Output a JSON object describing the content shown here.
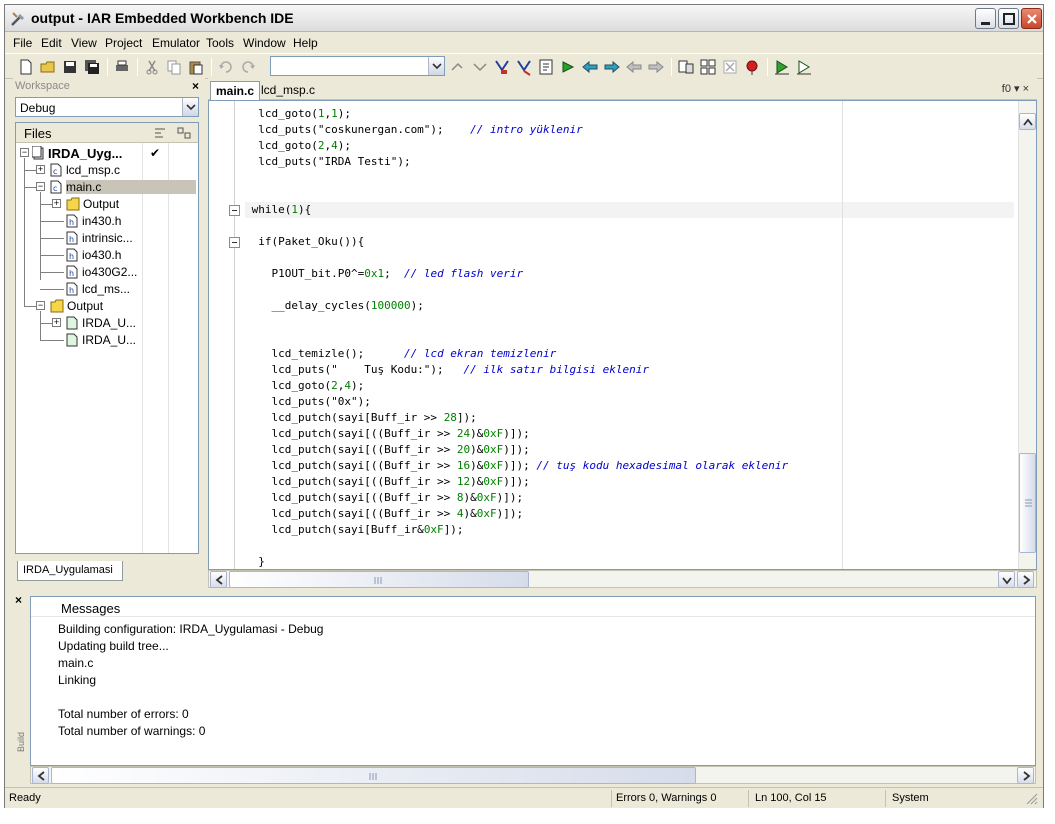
{
  "window": {
    "title": "output - IAR Embedded Workbench IDE"
  },
  "menu": [
    "File",
    "Edit",
    "View",
    "Project",
    "Emulator",
    "Tools",
    "Window",
    "Help"
  ],
  "workspace": {
    "title": "Workspace",
    "close": "×",
    "config": "Debug",
    "files_header": "Files",
    "tab": "IRDA_Uygulamasi",
    "tree": [
      {
        "label": "IRDA_Uyg...",
        "check": "✔"
      },
      {
        "label": "lcd_msp.c"
      },
      {
        "label": "main.c"
      },
      {
        "label": "Output"
      },
      {
        "label": "in430.h"
      },
      {
        "label": "intrinsic..."
      },
      {
        "label": "io430.h"
      },
      {
        "label": "io430G2..."
      },
      {
        "label": "lcd_ms..."
      },
      {
        "label": "Output"
      },
      {
        "label": "IRDA_U..."
      },
      {
        "label": "IRDA_U..."
      }
    ]
  },
  "editor": {
    "tabs": [
      "main.c",
      "lcd_msp.c"
    ],
    "right_label": "f0 ▾ ×",
    "lines": [
      {
        "code": "  lcd_goto(1,1);",
        "comment": ""
      },
      {
        "code": "  lcd_puts(\"coskunergan.com\");",
        "comment": "    // intro yüklenir"
      },
      {
        "code": "  lcd_goto(2,4);",
        "comment": ""
      },
      {
        "code": "  lcd_puts(\"IRDA Testi\");",
        "comment": ""
      },
      {
        "code": "",
        "comment": ""
      },
      {
        "code": "",
        "comment": ""
      },
      {
        "code": " while(1){",
        "comment": ""
      },
      {
        "code": "",
        "comment": ""
      },
      {
        "code": "  if(Paket_Oku()){",
        "comment": ""
      },
      {
        "code": "",
        "comment": ""
      },
      {
        "code": "    P1OUT_bit.P0^=0x1;",
        "comment": "  // led flash verir"
      },
      {
        "code": "",
        "comment": ""
      },
      {
        "code": "    __delay_cycles(100000);",
        "comment": ""
      },
      {
        "code": "",
        "comment": ""
      },
      {
        "code": "",
        "comment": ""
      },
      {
        "code": "    lcd_temizle();",
        "comment": "      // lcd ekran temizlenir"
      },
      {
        "code": "    lcd_puts(\"    Tuş Kodu:\");",
        "comment": "   // ilk satır bilgisi eklenir"
      },
      {
        "code": "    lcd_goto(2,4);",
        "comment": ""
      },
      {
        "code": "    lcd_puts(\"0x\");",
        "comment": ""
      },
      {
        "code": "    lcd_putch(sayi[Buff_ir >> 28]);",
        "comment": ""
      },
      {
        "code": "    lcd_putch(sayi[((Buff_ir >> 24)&0xF)]);",
        "comment": ""
      },
      {
        "code": "    lcd_putch(sayi[((Buff_ir >> 20)&0xF)]);",
        "comment": ""
      },
      {
        "code": "    lcd_putch(sayi[((Buff_ir >> 16)&0xF)]);",
        "comment": " // tuş kodu hexadesimal olarak eklenir"
      },
      {
        "code": "    lcd_putch(sayi[((Buff_ir >> 12)&0xF)]);",
        "comment": ""
      },
      {
        "code": "    lcd_putch(sayi[((Buff_ir >> 8)&0xF)]);",
        "comment": ""
      },
      {
        "code": "    lcd_putch(sayi[((Buff_ir >> 4)&0xF)]);",
        "comment": ""
      },
      {
        "code": "    lcd_putch(sayi[Buff_ir&0xF]);",
        "comment": ""
      },
      {
        "code": "",
        "comment": ""
      },
      {
        "code": "  }",
        "comment": ""
      }
    ]
  },
  "messages": {
    "close": "×",
    "header": "Messages",
    "side_label": "Build",
    "lines": [
      "Building configuration: IRDA_Uygulamasi - Debug",
      "Updating build tree...",
      "main.c",
      "Linking",
      "",
      "Total number of errors: 0",
      "Total number of warnings: 0"
    ]
  },
  "status": {
    "ready": "Ready",
    "errors": "Errors 0, Warnings 0",
    "position": "Ln 100, Col 15",
    "mode": "System"
  }
}
